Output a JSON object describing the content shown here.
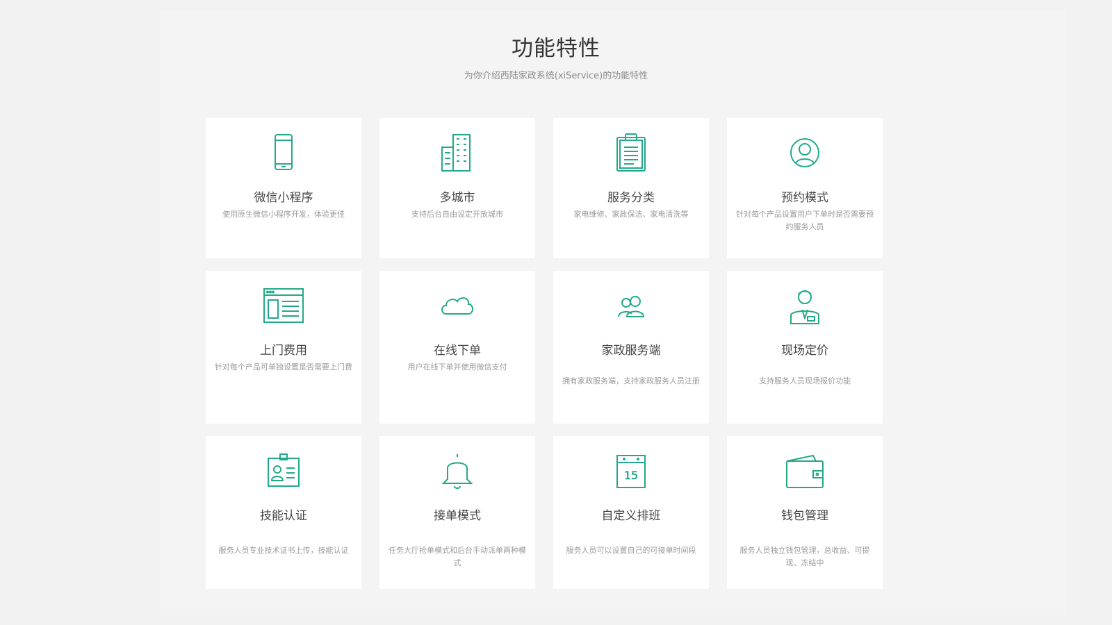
{
  "section": {
    "title": "功能特性",
    "subtitle": "为你介绍西陆家政系统(xiService)的功能特性"
  },
  "accent_color": "#22a98a",
  "features": [
    {
      "icon": "smartphone-icon",
      "title": "微信小程序",
      "desc": "使用原生微信小程序开发，体验更佳"
    },
    {
      "icon": "building-icon",
      "title": "多城市",
      "desc": "支持后台自由设定开放城市"
    },
    {
      "icon": "clipboard-icon",
      "title": "服务分类",
      "desc": "家电维修、家政保洁、家电清洗等"
    },
    {
      "icon": "user-circle-icon",
      "title": "预约模式",
      "desc": "针对每个产品设置用户下单时是否需要预约服务人员"
    },
    {
      "icon": "browser-window-icon",
      "title": "上门费用",
      "desc": "针对每个产品可单独设置是否需要上门费"
    },
    {
      "icon": "cloud-icon",
      "title": "在线下单",
      "desc": "用户在线下单并使用微信支付"
    },
    {
      "icon": "users-icon",
      "title": "家政服务端",
      "desc": "拥有家政服务端，支持家政服务人员注册"
    },
    {
      "icon": "staff-person-icon",
      "title": "现场定价",
      "desc": "支持服务人员现场报价功能"
    },
    {
      "icon": "id-card-icon",
      "title": "技能认证",
      "desc": "服务人员专业技术证书上传，技能认证"
    },
    {
      "icon": "bell-icon",
      "title": "接单模式",
      "desc": "任务大厅抢单模式和后台手动派单两种模式"
    },
    {
      "icon": "calendar-icon",
      "title": "自定义排班",
      "desc": "服务人员可以设置自己的可接单时间段",
      "calendar_day": "15"
    },
    {
      "icon": "wallet-icon",
      "title": "钱包管理",
      "desc": "服务人员独立钱包管理，总收益、可提现、冻结中"
    }
  ]
}
